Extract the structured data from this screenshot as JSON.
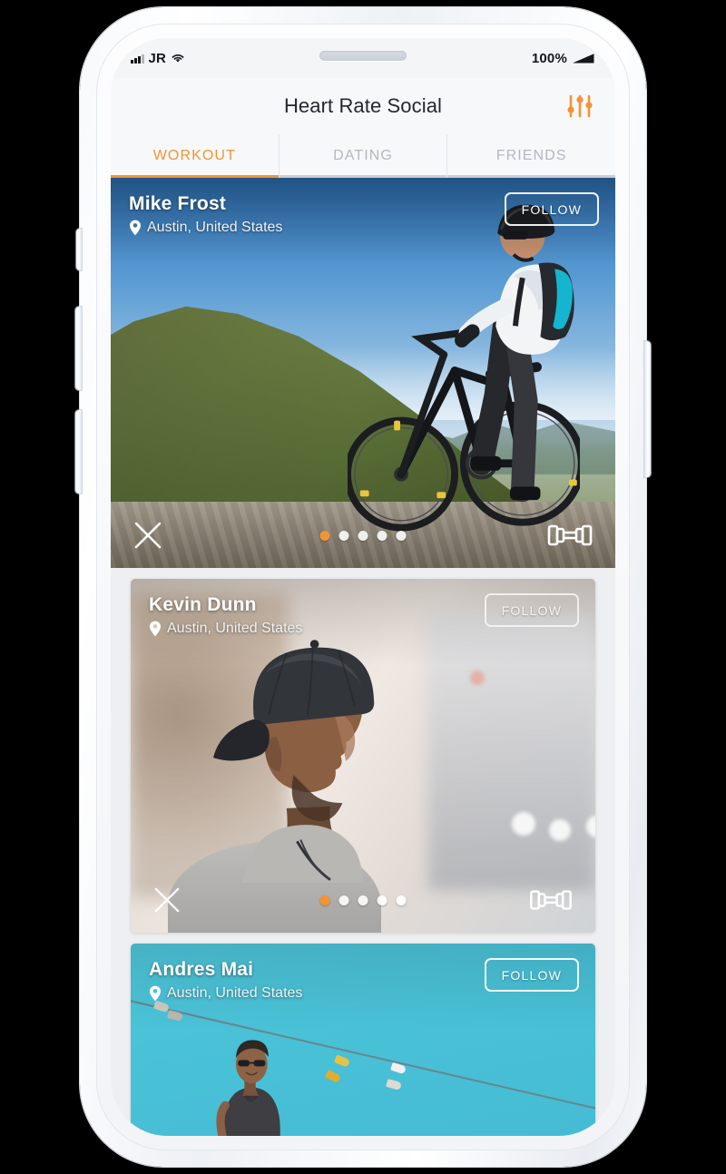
{
  "device": {
    "frame_color": "#f3f5f8",
    "status_bar": {
      "carrier": "JR",
      "signal_icon": "signal-bars-icon",
      "wifi_icon": "wifi-icon",
      "battery_percent": "100%",
      "battery_icon": "battery-full-icon"
    }
  },
  "header": {
    "title": "Heart Rate Social",
    "filter_icon": "sliders-icon",
    "accent_color": "#f39434"
  },
  "tabs": [
    {
      "label": "WORKOUT",
      "active": true
    },
    {
      "label": "DATING",
      "active": false
    },
    {
      "label": "FRIENDS",
      "active": false
    }
  ],
  "feed": {
    "cards": [
      {
        "name": "Mike Frost",
        "location": "Austin, United States",
        "location_icon": "map-pin-icon",
        "follow_label": "FOLLOW",
        "close_icon": "close-x-icon",
        "activity_icon": "dumbbell-icon",
        "photo_alt": "Mountain biker on a ridge overlooking green hills",
        "pager": {
          "total": 5,
          "active_index": 0,
          "active_color": "#f39434"
        }
      },
      {
        "name": "Kevin Dunn",
        "location": "Austin, United States",
        "location_icon": "map-pin-icon",
        "follow_label": "FOLLOW",
        "close_icon": "close-x-icon",
        "activity_icon": "dumbbell-icon",
        "photo_alt": "Man in a backwards cap in profile on a blurred city street",
        "pager": {
          "total": 5,
          "active_index": 0,
          "active_color": "#f39434"
        }
      },
      {
        "name": "Andres Mai",
        "location": "Austin, United States",
        "location_icon": "map-pin-icon",
        "follow_label": "FOLLOW",
        "photo_alt": "Man in sunglasses under a teal sky with shoes hanging from a wire",
        "background_color": "#49c1d7"
      }
    ]
  }
}
